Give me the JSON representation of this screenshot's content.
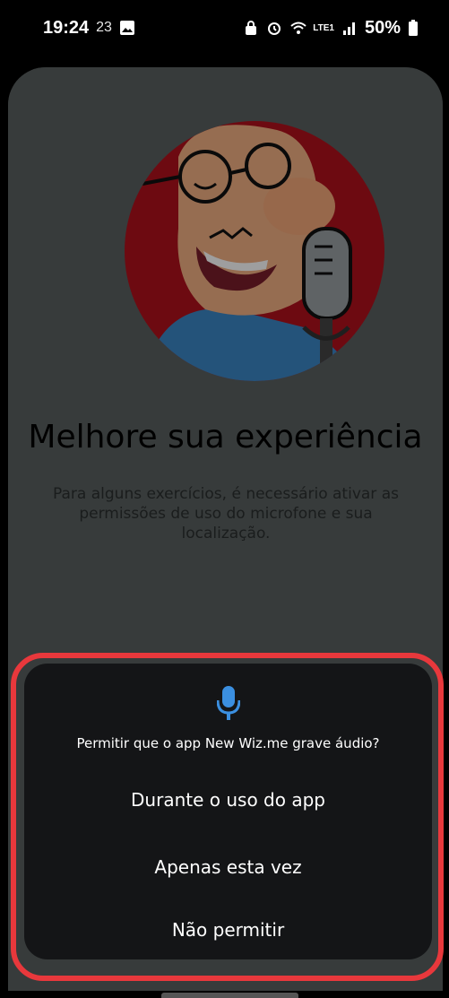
{
  "status_bar": {
    "time": "19:24",
    "date": "23",
    "network": "LTE1",
    "battery": "50%"
  },
  "screen": {
    "title": "Melhore sua experiência",
    "subtitle": "Para alguns exercícios, é necessário ativar as permissões de uso do microfone e sua localização."
  },
  "dialog": {
    "icon": "microphone-icon",
    "prompt": "Permitir que o app New Wiz.me grave áudio?",
    "options": [
      "Durante o uso do app",
      "Apenas esta vez",
      "Não permitir"
    ],
    "accent_color": "#3b8fe0",
    "highlight_color": "#e8383c"
  }
}
